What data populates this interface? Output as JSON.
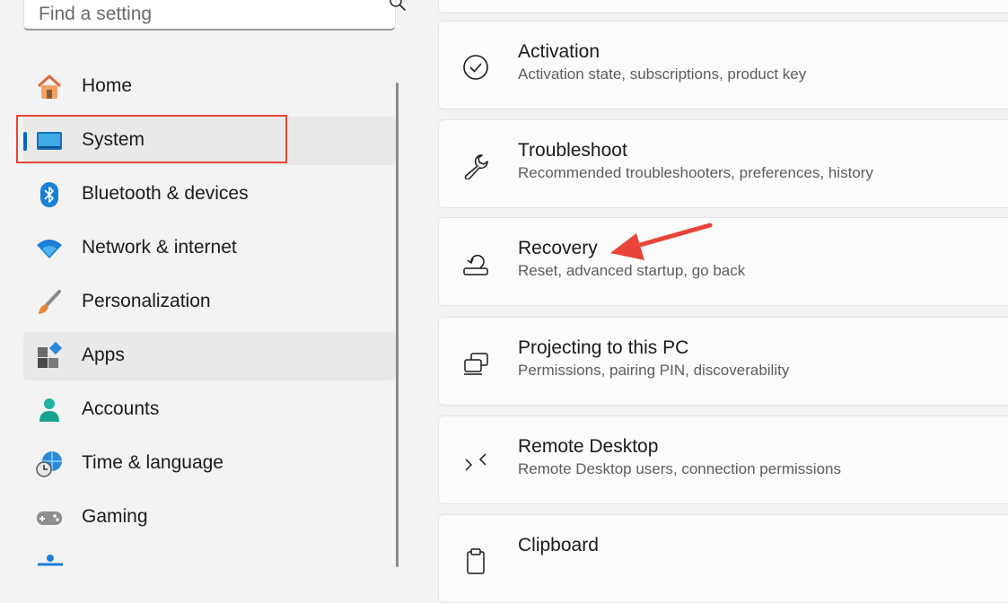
{
  "search": {
    "placeholder": "Find a setting",
    "icon": "search-icon"
  },
  "sidebar": {
    "items": [
      {
        "label": "Home",
        "icon": "home-icon"
      },
      {
        "label": "System",
        "icon": "system-display-icon",
        "selected": true
      },
      {
        "label": "Bluetooth & devices",
        "icon": "bluetooth-icon"
      },
      {
        "label": "Network & internet",
        "icon": "wifi-icon"
      },
      {
        "label": "Personalization",
        "icon": "brush-icon"
      },
      {
        "label": "Apps",
        "icon": "apps-icon",
        "hover": true
      },
      {
        "label": "Accounts",
        "icon": "person-icon"
      },
      {
        "label": "Time & language",
        "icon": "globe-clock-icon"
      },
      {
        "label": "Gaming",
        "icon": "gamepad-icon"
      }
    ]
  },
  "settings": {
    "items": [
      {
        "title": "Activation",
        "description": "Activation state, subscriptions, product key",
        "icon": "check-circle-icon"
      },
      {
        "title": "Troubleshoot",
        "description": "Recommended troubleshooters, preferences, history",
        "icon": "wrench-icon"
      },
      {
        "title": "Recovery",
        "description": "Reset, advanced startup, go back",
        "icon": "recovery-icon"
      },
      {
        "title": "Projecting to this PC",
        "description": "Permissions, pairing PIN, discoverability",
        "icon": "projecting-icon"
      },
      {
        "title": "Remote Desktop",
        "description": "Remote Desktop users, connection permissions",
        "icon": "remote-desktop-icon"
      },
      {
        "title": "Clipboard",
        "description": "",
        "icon": "clipboard-icon"
      }
    ]
  },
  "annotation": {
    "highlight_color": "#e8443a",
    "arrow_color": "#e8443a"
  },
  "colors": {
    "accent": "#0067c0"
  }
}
